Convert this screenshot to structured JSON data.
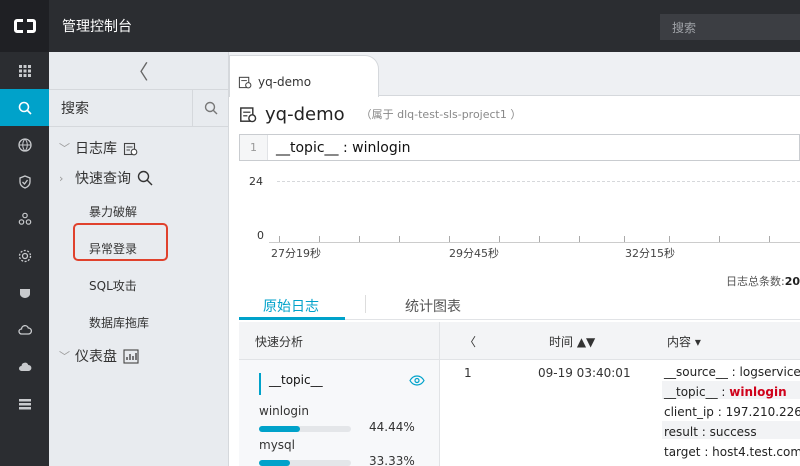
{
  "topbar": {
    "title": "管理控制台",
    "search_placeholder": "搜索"
  },
  "rail": {
    "icons": [
      "grid-icon",
      "log-service-icon",
      "globe-icon",
      "shield-icon",
      "cluster-icon",
      "gear-icon",
      "badge-icon",
      "cloud-icon",
      "cloud-upload-icon",
      "stack-icon"
    ],
    "active_index": 1
  },
  "sidebar": {
    "collapse_glyph": "〈",
    "search_label": "搜索",
    "logstore_label": "日志库",
    "quick_query_label": "快速查询",
    "queries": [
      "暴力破解",
      "异常登录",
      "SQL攻击",
      "数据库拖库"
    ],
    "dashboard_label": "仪表盘"
  },
  "main": {
    "tab_label": "yq-demo",
    "title": "yq-demo",
    "project": "（属于 dlq-test-sls-project1 ）",
    "query": {
      "line_no": "1",
      "text": "__topic__ : winlogin"
    },
    "histogram": {
      "ymax": "24",
      "ymin": "0",
      "ticks": [
        "27分19秒",
        "29分45秒",
        "32分15秒"
      ]
    },
    "count_label": "日志总条数:",
    "count_value": "20",
    "subtabs": [
      "原始日志",
      "统计图表"
    ],
    "quick_analysis": "快速分析",
    "columns": {
      "nav": "〈",
      "time": "时间 ▲▼",
      "content": "内容 ▾"
    },
    "field": {
      "name": "__topic__",
      "values": [
        {
          "label": "winlogin",
          "pct": "44.44%",
          "fraction": 0.4444
        },
        {
          "label": "mysql",
          "pct": "33.33%",
          "fraction": 0.3333
        }
      ]
    },
    "log": {
      "index": "1",
      "time": "09-19 03:40:01",
      "fields": [
        {
          "key": "__source__",
          "value": "logservice"
        },
        {
          "key": "__topic__",
          "value": "winlogin"
        },
        {
          "key": "client_ip",
          "value": "197.210.226"
        },
        {
          "key": "result",
          "value": "success"
        },
        {
          "key": "target",
          "value": "host4.test.com"
        }
      ]
    }
  },
  "colors": {
    "accent": "#00a2ca",
    "highlight": "#e0412c",
    "topbar": "#2b2d31",
    "keyword": "#d0021b"
  }
}
